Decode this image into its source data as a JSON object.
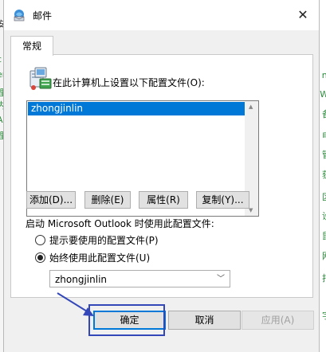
{
  "window": {
    "title": "邮件",
    "close_symbol": "✕"
  },
  "tabs": [
    {
      "label": "常规",
      "selected": true
    }
  ],
  "profile_section": {
    "label": "在此计算机上设置以下配置文件(O):",
    "profiles": [
      "zhongjinlin"
    ],
    "selected_profile": "zhongjinlin"
  },
  "buttons": {
    "add": "添加(D)...",
    "delete": "删除(E)",
    "properties": "属性(R)",
    "copy": "复制(Y)..."
  },
  "startup": {
    "label": "启动 Microsoft Outlook 时使用此配置文件:",
    "options": [
      {
        "label": "提示要使用的配置文件(P)",
        "checked": false
      },
      {
        "label": "始终使用此配置文件(U)",
        "checked": true
      }
    ],
    "dropdown_value": "zhongjinlin"
  },
  "footer": {
    "ok": "确定",
    "cancel": "取消",
    "apply": "应用(A)"
  },
  "background": {
    "left_fragments": [
      "安",
      "c",
      "er",
      "理",
      "内",
      "A",
      "理"
    ],
    "right_fragments": [
      "nt",
      "Wi",
      "备",
      "电",
      "管",
      "获",
      "区",
      "设",
      "鼠",
      "网",
      "打",
      "字"
    ]
  },
  "colors": {
    "selection": "#0078d7",
    "annotation": "#3347b8",
    "background_link_green": "#2a8a3a"
  },
  "icons": {
    "mail-icon": "envelope-globe",
    "profile-icon": "computer-card-file",
    "dropdown-chevron": "chevron-down"
  }
}
